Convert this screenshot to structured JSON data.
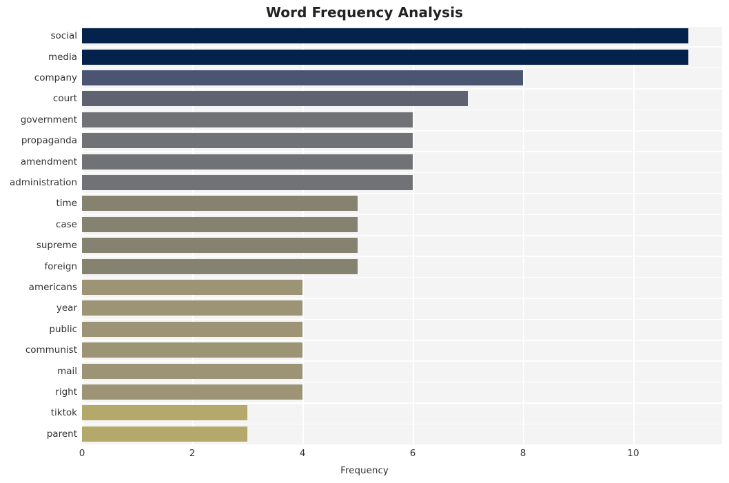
{
  "chart_data": {
    "type": "bar",
    "orientation": "horizontal",
    "title": "Word Frequency Analysis",
    "xlabel": "Frequency",
    "ylabel": "",
    "xlim": [
      0,
      11.6
    ],
    "ylim": [
      0,
      20
    ],
    "grid": true,
    "legend": null,
    "xticks": [
      "0",
      "2",
      "4",
      "6",
      "8",
      "10"
    ],
    "xtick_values": [
      0,
      2,
      4,
      6,
      8,
      10
    ],
    "categories": [
      "social",
      "media",
      "company",
      "court",
      "government",
      "propaganda",
      "amendment",
      "administration",
      "time",
      "case",
      "supreme",
      "foreign",
      "americans",
      "year",
      "public",
      "communist",
      "mail",
      "right",
      "tiktok",
      "parent"
    ],
    "values": [
      11,
      11,
      8,
      7,
      6,
      6,
      6,
      6,
      5,
      5,
      5,
      5,
      4,
      4,
      4,
      4,
      4,
      4,
      3,
      3
    ],
    "bar_colors": [
      "#04234c",
      "#04234c",
      "#4b5471",
      "#5f6270",
      "#717275",
      "#717275",
      "#717275",
      "#717275",
      "#85836f",
      "#85836f",
      "#85836f",
      "#85836f",
      "#9c9475",
      "#9c9475",
      "#9c9475",
      "#9c9475",
      "#9c9475",
      "#9c9475",
      "#b4a86a",
      "#b4a86a"
    ],
    "plot_background": "#f4f4f5",
    "grid_color": "#ffffff",
    "figure_background": "#ffffff"
  }
}
